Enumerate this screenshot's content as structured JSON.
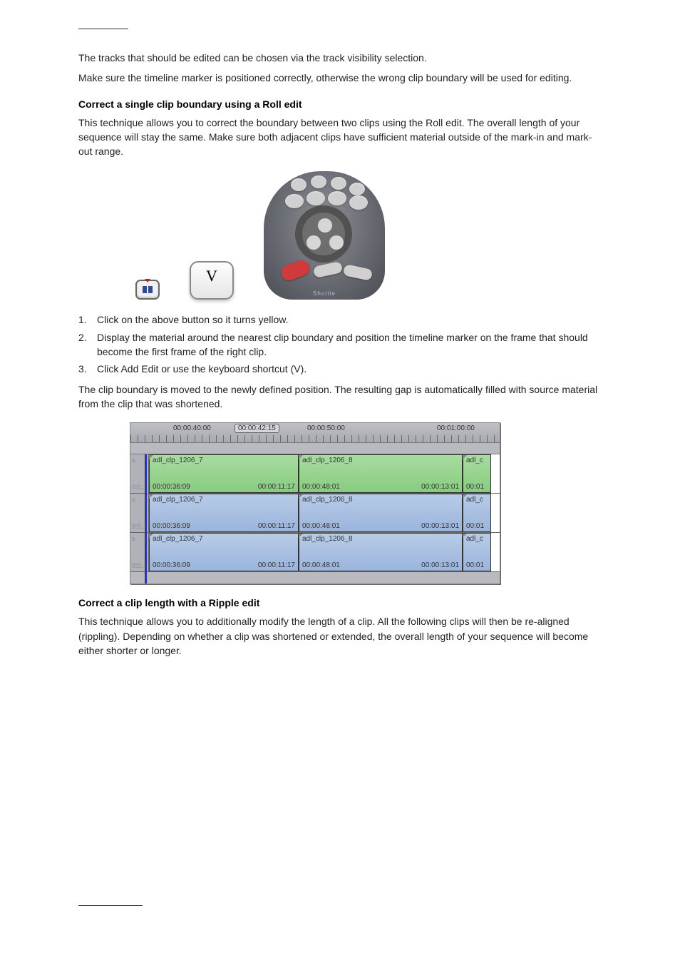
{
  "intro": {
    "p1": "The tracks that should be edited can be chosen via the track visibility selection.",
    "p2": "Make sure the timeline marker is positioned correctly, otherwise the wrong clip boundary will be used for editing."
  },
  "section1": {
    "title": "Correct a single clip boundary using a Roll edit",
    "p1": "This technique allows you to correct the boundary between two clips using the Roll edit. The overall length of your sequence will stay the same. Make sure both adjacent clips have sufficient material outside of the mark-in and mark-out range.",
    "key_v": "V",
    "steps": [
      "Click on the above button so it turns yellow.",
      "Display the material around the nearest clip boundary and position the timeline marker on the frame that should become the first frame of the right clip.",
      "Click Add Edit or use the keyboard shortcut (V)."
    ],
    "p2": "The clip boundary is moved to the newly defined position. The resulting gap is automatically filled with source material from the clip that was shortened."
  },
  "timeline": {
    "ruler": {
      "t1": "00:00:40:00",
      "t2": "00:00:50:00",
      "t3": "00:01:00:00"
    },
    "marker": "00:00:42:15",
    "gutter": {
      "top": "s",
      "bot": "0:0.."
    },
    "clips": {
      "c1": {
        "name": "adl_clp_1206_7",
        "in": "00:00:36:09",
        "dur": "00:00:11:17"
      },
      "c2": {
        "name": "adl_clp_1206_8",
        "in": "00:00:48:01",
        "dur": "00:00:13:01"
      },
      "c3": {
        "name": "adl_c",
        "in": "00:01"
      }
    }
  },
  "section2": {
    "title": "Correct a clip length with a Ripple edit",
    "p1": "This technique allows you to additionally modify the length of a clip. All the following clips will then be re-aligned (rippling). Depending on whether a clip was shortened or extended, the overall length of your sequence will become either shorter or longer."
  }
}
